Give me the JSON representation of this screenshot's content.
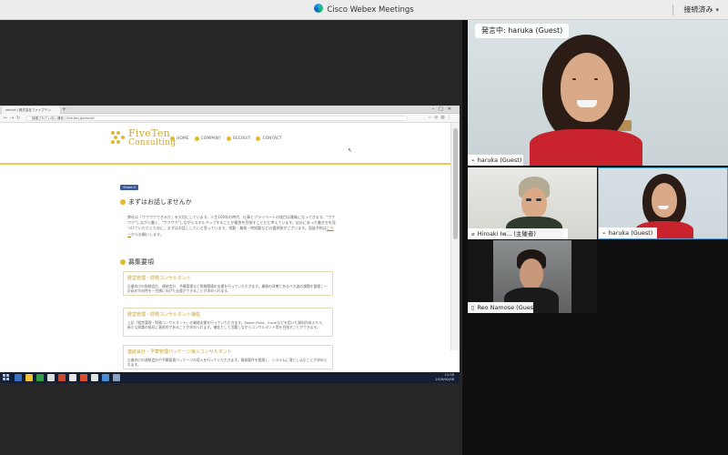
{
  "window": {
    "title": "Cisco Webex Meetings",
    "status_label": "接続済み",
    "status_chevron": "chevron-down-icon"
  },
  "shared_screen": {
    "browser": {
      "tab_title": "recruit | 株式会社ファイブテン",
      "address_text": "保護されていない通信 | five-ten.jp/recruit"
    },
    "site": {
      "logo_line1": "FiveTen",
      "logo_line2": "Consulting",
      "nav": [
        "HOME",
        "COMPANY",
        "RECRUIT",
        "CONTACT"
      ],
      "share_button": "Share 0",
      "section1_title": "まずはお話しませんか",
      "section1_text": "弊社は「ワクワクできるか」を大切にしています。人生100年の時代、仕事とプライベートの境目は曖昧になってきます。\"ワクワク\"しながら働く、\"ワクワク\"しながらスキルアップすることが最良を目指すことだと考えています。自分にあった働き方を見つけていただくために、まずはお話ししたいと思っています。常勤・業務・時短勤などの選択肢がございます。面談予約は",
      "section1_link": "こちら",
      "section1_tail": "からお願いします。",
      "section2_title": "募集要項",
      "jobs": [
        {
          "title": "経営管理・財務コンサルタント",
          "desc": "企業向けの財務会計、連結会計、予算管理など財務関連の支援を行っていただきます。業務の改善とあるべき姿の課題を整理し一計画の方向性を一目標に向けた支援ができることが求められます。"
        },
        {
          "title": "経営管理・財務コンサルタント補佐",
          "desc": "上記「経営管理・財務コンサルタント」の業務支援を行っていただきます。Power Point、Excelなどを用いた資料作成スキル、新たな知識の吸収に意欲的であることが求められます。補佐として活躍しながらコンサルタント等を目指すことができます。"
        },
        {
          "title": "連結会計・予算管理パッケージ導入コンサルタント",
          "desc": "企業向けの連結会計や予算管理パッケージの導入を行っていただきます。業務要件を整理し、システムに落とし込むことが求められます。"
        }
      ]
    },
    "taskbar": {
      "time": "11:30",
      "date": "2019/02/06"
    }
  },
  "participants": {
    "active_speaker": {
      "speaking_label": "発言中: haruka (Guest)",
      "name": "haruka (Guest)"
    },
    "tiles": [
      {
        "name": "Hiroaki Iw...",
        "role": "(主催者)"
      },
      {
        "name": "haruka (Guest)",
        "role": ""
      },
      {
        "name": "Reo Namose (Guest)",
        "role": ""
      }
    ]
  },
  "colors": {
    "accent": "#e3b92f",
    "active_border": "#4fa6d8",
    "taskbar": "#141f33"
  }
}
